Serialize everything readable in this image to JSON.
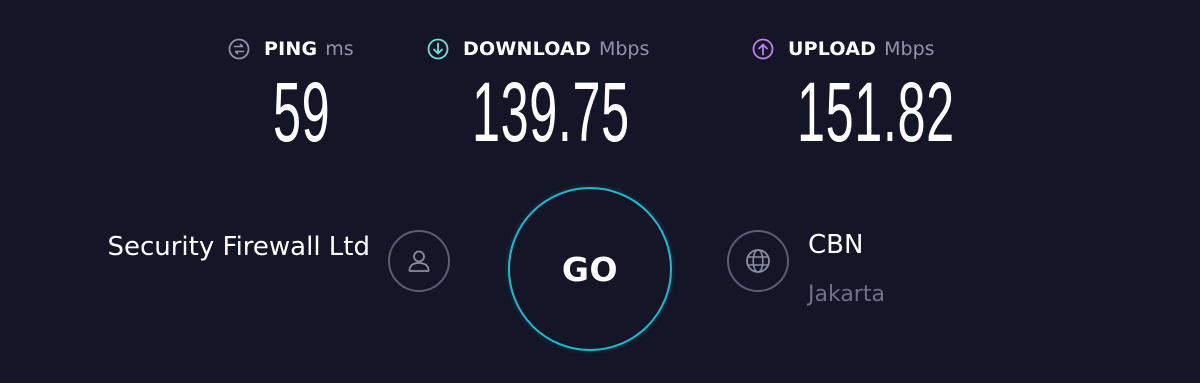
{
  "colors": {
    "background": "#141526",
    "ping_icon": "#9193a8",
    "download_icon": "#6fe0d8",
    "upload_icon": "#c07ef0",
    "go_ring": "#1fb9cf",
    "muted_text": "#6f7188"
  },
  "metrics": {
    "ping": {
      "icon": "ping-icon",
      "label": "PING",
      "unit": "ms",
      "value": "59"
    },
    "download": {
      "icon": "download-arrow-icon",
      "label": "DOWNLOAD",
      "unit": "Mbps",
      "value": "139.75"
    },
    "upload": {
      "icon": "upload-arrow-icon",
      "label": "UPLOAD",
      "unit": "Mbps",
      "value": "151.82"
    }
  },
  "isp": {
    "name": "Security Firewall Ltd",
    "icon": "user-icon"
  },
  "go_button": {
    "label": "GO"
  },
  "server": {
    "icon": "globe-icon",
    "name": "CBN",
    "location": "Jakarta"
  }
}
